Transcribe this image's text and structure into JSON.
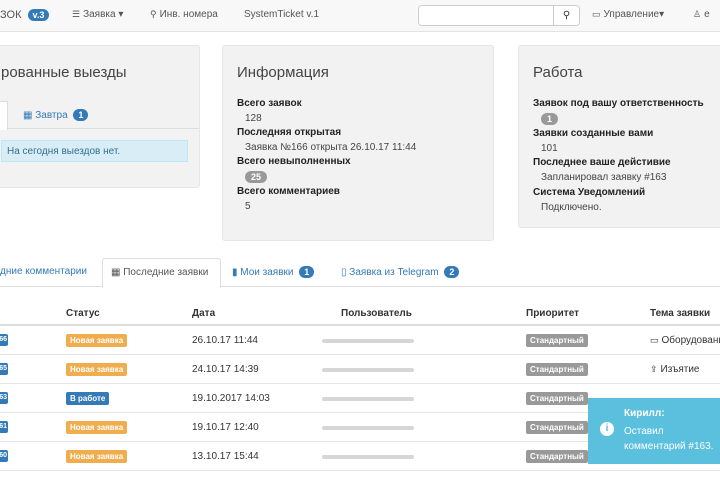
{
  "navbar": {
    "brand": "ЗОК",
    "version": "v.3",
    "menu_tickets": "Заявка",
    "inventory": "Инв. номера",
    "system_ticket": "SystemTicket v.1",
    "manage": "Управление",
    "user": "е",
    "search_placeholder": ""
  },
  "panels": {
    "visits": {
      "title": "рованные выезды",
      "tab_tomorrow": "Завтра",
      "tab_tomorrow_count": "1",
      "alert": "На сегодня выездов нет."
    },
    "info": {
      "title": "Информация",
      "total_label": "Всего заявок",
      "total_value": "128",
      "last_opened_label": "Последняя открытая",
      "last_opened_value": "Заявка №166 открыта 26.10.17 11:44",
      "unfinished_label": "Всего невыполненных",
      "unfinished_value": "25",
      "comments_label": "Всего комментариев",
      "comments_value": "5"
    },
    "work": {
      "title": "Работа",
      "responsible_label": "Заявок под вашу ответственность",
      "responsible_value": "1",
      "created_label": "Заявки созданные вами",
      "created_value": "101",
      "last_action_label": "Последнее ваше дейстивие",
      "last_action_value": "Запланировал заявку #163",
      "notifications_label": "Система Уведомлений",
      "notifications_value": "Подключено."
    }
  },
  "tabs": {
    "comments": "дние комментарии",
    "recent": "Последние заявки",
    "my": "Мои заявки",
    "my_count": "1",
    "telegram": "Заявка из Telegram",
    "telegram_count": "2"
  },
  "table": {
    "headers": {
      "status": "Статус",
      "date": "Дата",
      "user": "Пользователь",
      "priority": "Приоритет",
      "topic": "Тема заявки"
    },
    "rows": [
      {
        "id": "66",
        "status": "Новая заявка",
        "status_color": "#f0ad4e",
        "date": "26.10.17 11:44",
        "priority": "Стандартный",
        "topic": "Оборудование",
        "topic_icon": "monitor-icon"
      },
      {
        "id": "65",
        "status": "Новая заявка",
        "status_color": "#f0ad4e",
        "date": "24.10.17 14:39",
        "priority": "Стандартный",
        "topic": "Изъятие",
        "topic_icon": "upload-icon"
      },
      {
        "id": "63",
        "status": "В работе",
        "status_color": "#337ab7",
        "date": "19.10.2017 14:03",
        "priority": "Стандартный",
        "topic": "",
        "topic_icon": ""
      },
      {
        "id": "61",
        "status": "Новая заявка",
        "status_color": "#f0ad4e",
        "date": "19.10.17 12:40",
        "priority": "Стандартный",
        "topic": "",
        "topic_icon": ""
      },
      {
        "id": "60",
        "status": "Новая заявка",
        "status_color": "#f0ad4e",
        "date": "13.10.17 15:44",
        "priority": "Стандартный",
        "topic": "",
        "topic_icon": ""
      }
    ]
  },
  "toast": {
    "title": "Кирилл:",
    "message": "Оставил комментарий #163."
  }
}
